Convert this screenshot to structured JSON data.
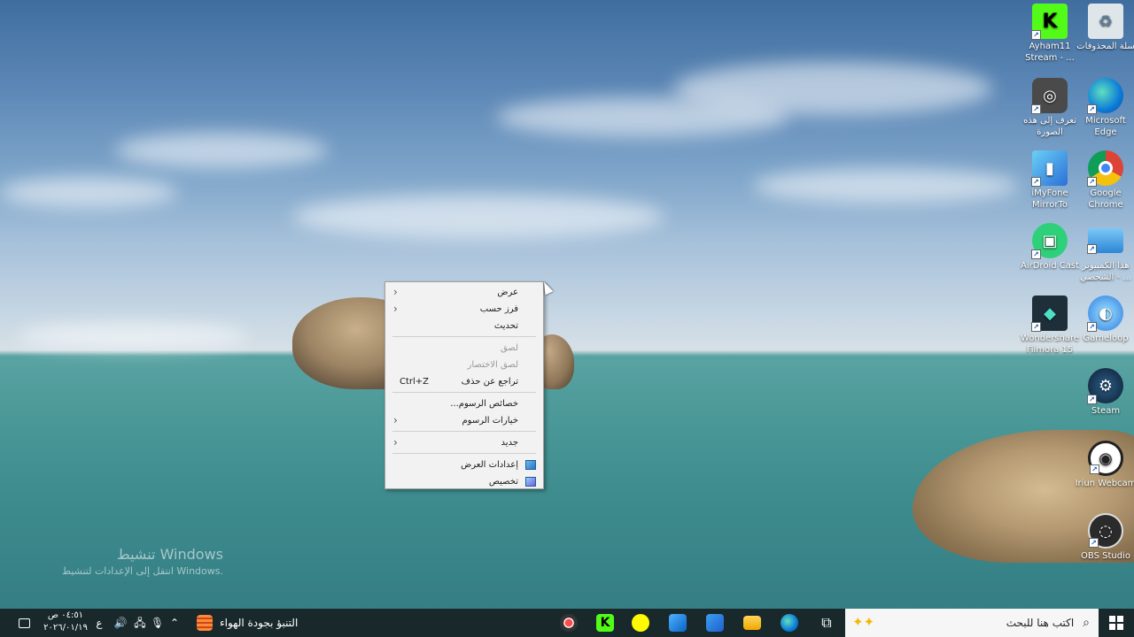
{
  "desktop": {
    "icons": [
      {
        "id": "recycle",
        "label": "سلة المحذوفات"
      },
      {
        "id": "kick",
        "label": "Ayham11 Stream - ..."
      },
      {
        "id": "edge",
        "label": "Microsoft Edge"
      },
      {
        "id": "photo",
        "label": "تعرف إلى هذه الصورة"
      },
      {
        "id": "chrome",
        "label": "Google Chrome"
      },
      {
        "id": "imyfone",
        "label": "iMyFone MirrorTo"
      },
      {
        "id": "thispc",
        "label": "هذا الكمبيوتر الشخصي - ..."
      },
      {
        "id": "airdroid",
        "label": "AirDroid Cast"
      },
      {
        "id": "gameloop",
        "label": "Gameloop"
      },
      {
        "id": "filmora",
        "label": "Wondershare Filmora 15"
      },
      {
        "id": "steam",
        "label": "Steam"
      },
      {
        "id": "iriun",
        "label": "Iriun Webcam"
      },
      {
        "id": "obs",
        "label": "OBS Studio"
      }
    ]
  },
  "watermark": {
    "line1": "تنشيط Windows",
    "line2": "انتقل إلى الإعدادات لتنشيط Windows."
  },
  "context_menu": {
    "view": "عرض",
    "sort_by": "فرز حسب",
    "refresh": "تحديث",
    "paste": "لصق",
    "paste_shortcut": "لصق الاختصار",
    "undo_delete": "تراجع عن حذف",
    "undo_shortcut": "Ctrl+Z",
    "graphics_properties": "خصائص الرسوم...",
    "graphics_options": "خيارات الرسوم",
    "new": "جديد",
    "display_settings": "إعدادات العرض",
    "personalize": "تخصيص"
  },
  "taskbar": {
    "search_placeholder": "اكتب هنا للبحث",
    "weather_text": "التنبؤ بجودة الهواء",
    "clock_time": "٠٤:٥١ ص",
    "clock_date": "٢٠٢٦/٠١/١٩",
    "language": "ع"
  }
}
